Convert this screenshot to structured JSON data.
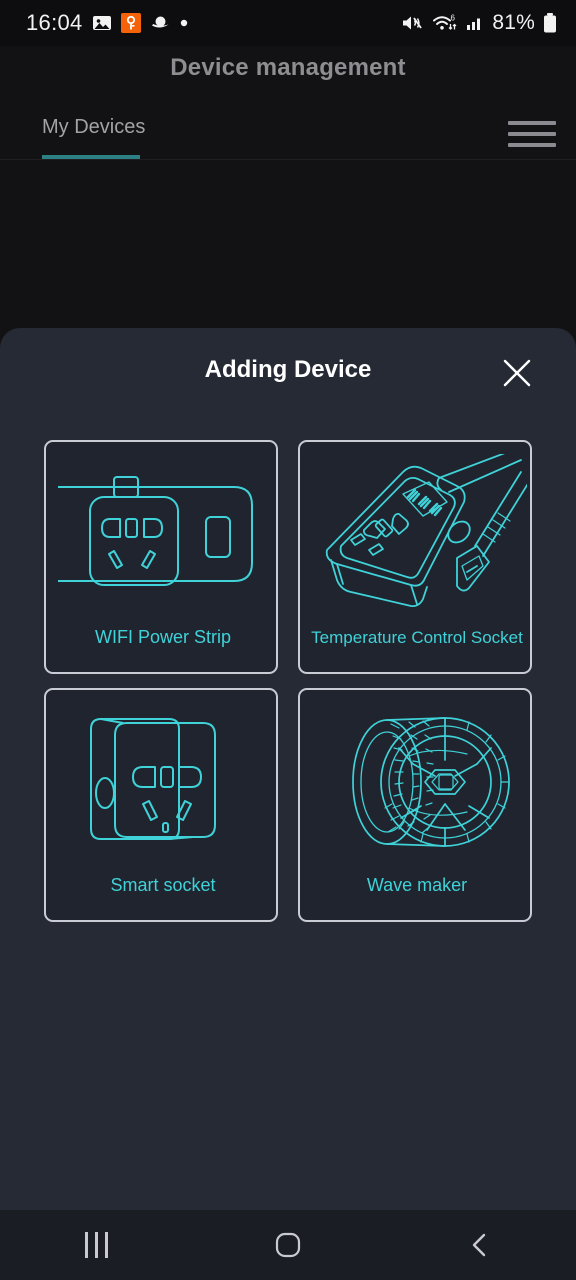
{
  "status_bar": {
    "time": "16:04",
    "battery_percent": "81%",
    "left_icons": [
      "image-icon",
      "key-badge-icon",
      "saturn-icon",
      "dot-icon"
    ],
    "right_icons": [
      "mute-icon",
      "wifi6-icon",
      "signal-icon",
      "battery-icon"
    ]
  },
  "header": {
    "title": "Device management",
    "menu_icon": "hamburger-menu-icon"
  },
  "tabs": [
    {
      "label": "My Devices",
      "active": true
    }
  ],
  "sheet": {
    "title": "Adding Device",
    "close_icon": "close-icon"
  },
  "devices": [
    {
      "label": "WIFI Power Strip",
      "art": "wifi-power-strip-illustration"
    },
    {
      "label": "Temperature Control Socket",
      "art": "temperature-control-socket-illustration"
    },
    {
      "label": "Smart socket",
      "art": "smart-socket-illustration"
    },
    {
      "label": "Wave maker",
      "art": "wave-maker-illustration"
    }
  ],
  "nav_bar": {
    "recents_label": "recents-icon",
    "home_label": "home-icon",
    "back_label": "back-icon"
  },
  "colors": {
    "accent_teal": "#3fd2d8",
    "tab_underline": "#2c7f82",
    "sheet_bg": "#262a35",
    "page_bg": "#121214",
    "card_border": "#c9ccd4"
  }
}
